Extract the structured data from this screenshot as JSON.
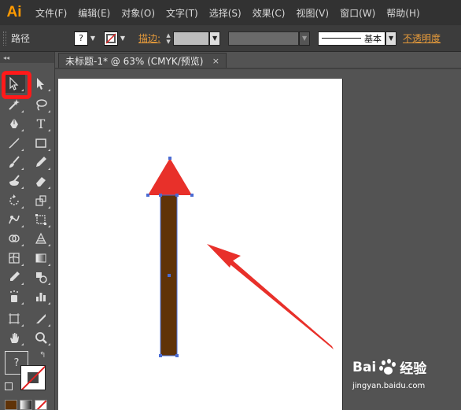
{
  "app": {
    "logo": "Ai"
  },
  "menu": {
    "items": [
      "文件(F)",
      "编辑(E)",
      "对象(O)",
      "文字(T)",
      "选择(S)",
      "效果(C)",
      "视图(V)",
      "窗口(W)",
      "帮助(H)"
    ]
  },
  "control_bar": {
    "path_label": "路径",
    "fill_value": "?",
    "stroke_label": "描边:",
    "brush_label": "基本",
    "opacity_label": "不透明度"
  },
  "document": {
    "tab_title": "未标题-1* @ 63% (CMYK/预览)",
    "close_glyph": "×"
  },
  "toolbar": {
    "tools": [
      [
        "selection-tool",
        "direct-selection-tool"
      ],
      [
        "magic-wand-tool",
        "lasso-tool"
      ],
      [
        "pen-tool",
        "type-tool"
      ],
      [
        "line-tool",
        "rectangle-tool"
      ],
      [
        "paintbrush-tool",
        "pencil-tool"
      ],
      [
        "blob-brush-tool",
        "eraser-tool"
      ],
      [
        "rotate-tool",
        "scale-tool"
      ],
      [
        "warp-tool",
        "free-transform-tool"
      ],
      [
        "shape-builder-tool",
        "perspective-grid-tool"
      ],
      [
        "mesh-tool",
        "gradient-tool"
      ],
      [
        "eyedropper-tool",
        "blend-tool"
      ],
      [
        "symbol-sprayer-tool",
        "column-graph-tool"
      ],
      [
        "artboard-tool",
        "slice-tool"
      ],
      [
        "hand-tool",
        "zoom-tool"
      ]
    ],
    "fill_label": "?",
    "type_glyph": "T"
  },
  "artwork": {
    "arrow_head_color": "#E8302A",
    "arrow_shaft_color": "#603308",
    "pointer_color": "#E8302A",
    "anchor_color": "#4A6CD4"
  },
  "watermark": {
    "brand": "Bai",
    "brand2": "经验",
    "url": "jingyan.baidu.com"
  }
}
